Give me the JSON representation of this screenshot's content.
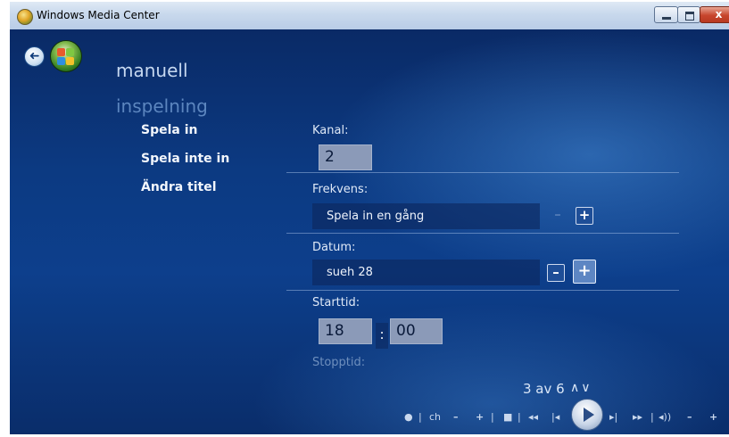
{
  "window": {
    "title": "Windows Media Center",
    "close_label": "x"
  },
  "nav": {
    "back_glyph": "➜"
  },
  "page": {
    "title_line1": "manuell",
    "title_line2": "inspelning"
  },
  "menu": {
    "items": [
      {
        "label": "Spela in"
      },
      {
        "label": "Spela inte in"
      },
      {
        "label": "Ändra titel"
      }
    ]
  },
  "form": {
    "channel": {
      "label": "Kanal:",
      "value": "2"
    },
    "frequency": {
      "label": "Frekvens:",
      "value": "Spela in en gång",
      "minus": "–",
      "plus": "+"
    },
    "date": {
      "label": "Datum:",
      "value": "sueh 28",
      "minus": "–",
      "plus": "+"
    },
    "start_time": {
      "label": "Starttid:",
      "hour": "18",
      "separator": ":",
      "minute": "00"
    },
    "stop_time": {
      "label": "Stopptid:"
    }
  },
  "pager": {
    "text": "3 av 6",
    "arrows": "∧∨"
  },
  "transport": {
    "record": "●",
    "sep": "|",
    "ch": "ch",
    "ch_minus": "–",
    "ch_plus": "+",
    "stop": "■",
    "rewind": "◂◂",
    "skip_back": "|◂",
    "skip_fwd": "▸|",
    "fast_fwd": "▸▸",
    "mute": "◂))",
    "vol_minus": "–",
    "vol_plus": "+"
  },
  "colors": {
    "background": "#0c3a82",
    "titlebar": "#c8d8ec",
    "accent": "#1e4e97"
  }
}
